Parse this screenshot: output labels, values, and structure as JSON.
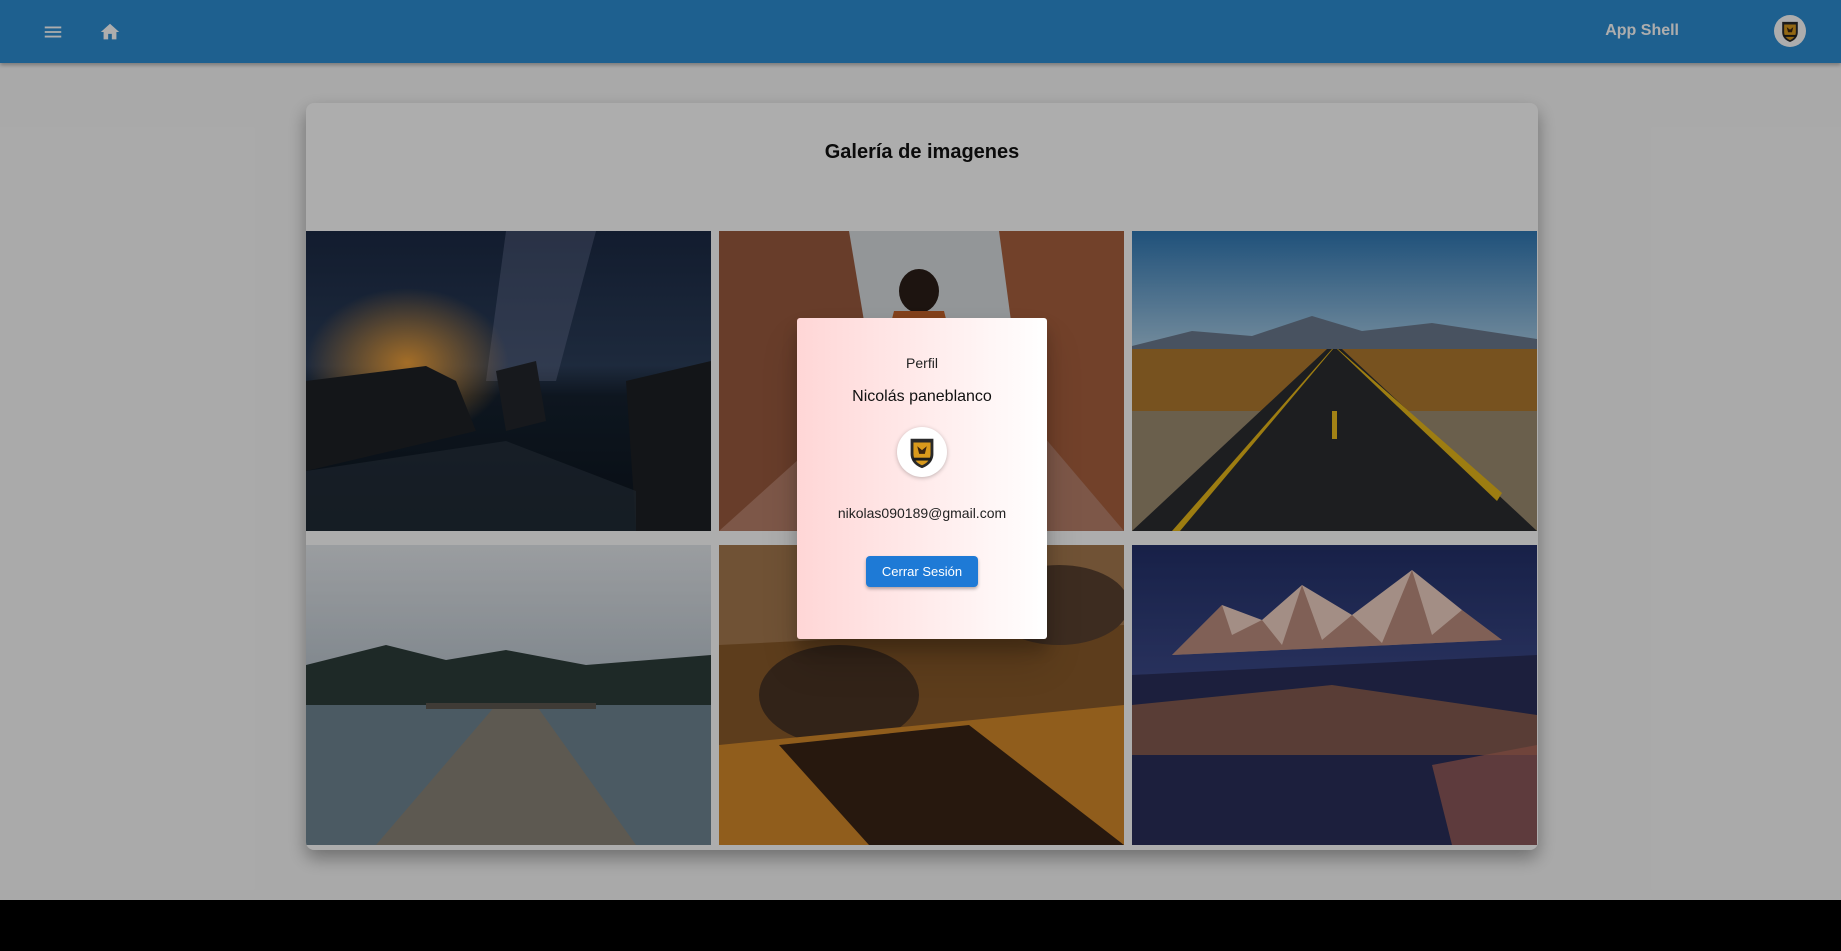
{
  "toolbar": {
    "app_title": "App Shell",
    "icons": [
      "menu-icon",
      "home-icon",
      "avatar-badge-icon"
    ],
    "color": "#2d8ed3"
  },
  "gallery": {
    "title": "Galería de imagenes",
    "images": [
      {
        "name": "night-sky-coast-image"
      },
      {
        "name": "canyon-woman-image"
      },
      {
        "name": "desert-road-image"
      },
      {
        "name": "lake-pier-image"
      },
      {
        "name": "desert-rocks-image"
      },
      {
        "name": "snowy-mountain-beach-image"
      }
    ]
  },
  "profile_dialog": {
    "heading": "Perfil",
    "name": "Nicolás paneblanco",
    "email": "nikolas090189@gmail.com",
    "logout_label": "Cerrar Sesión",
    "button_color": "#1e7ad6"
  }
}
